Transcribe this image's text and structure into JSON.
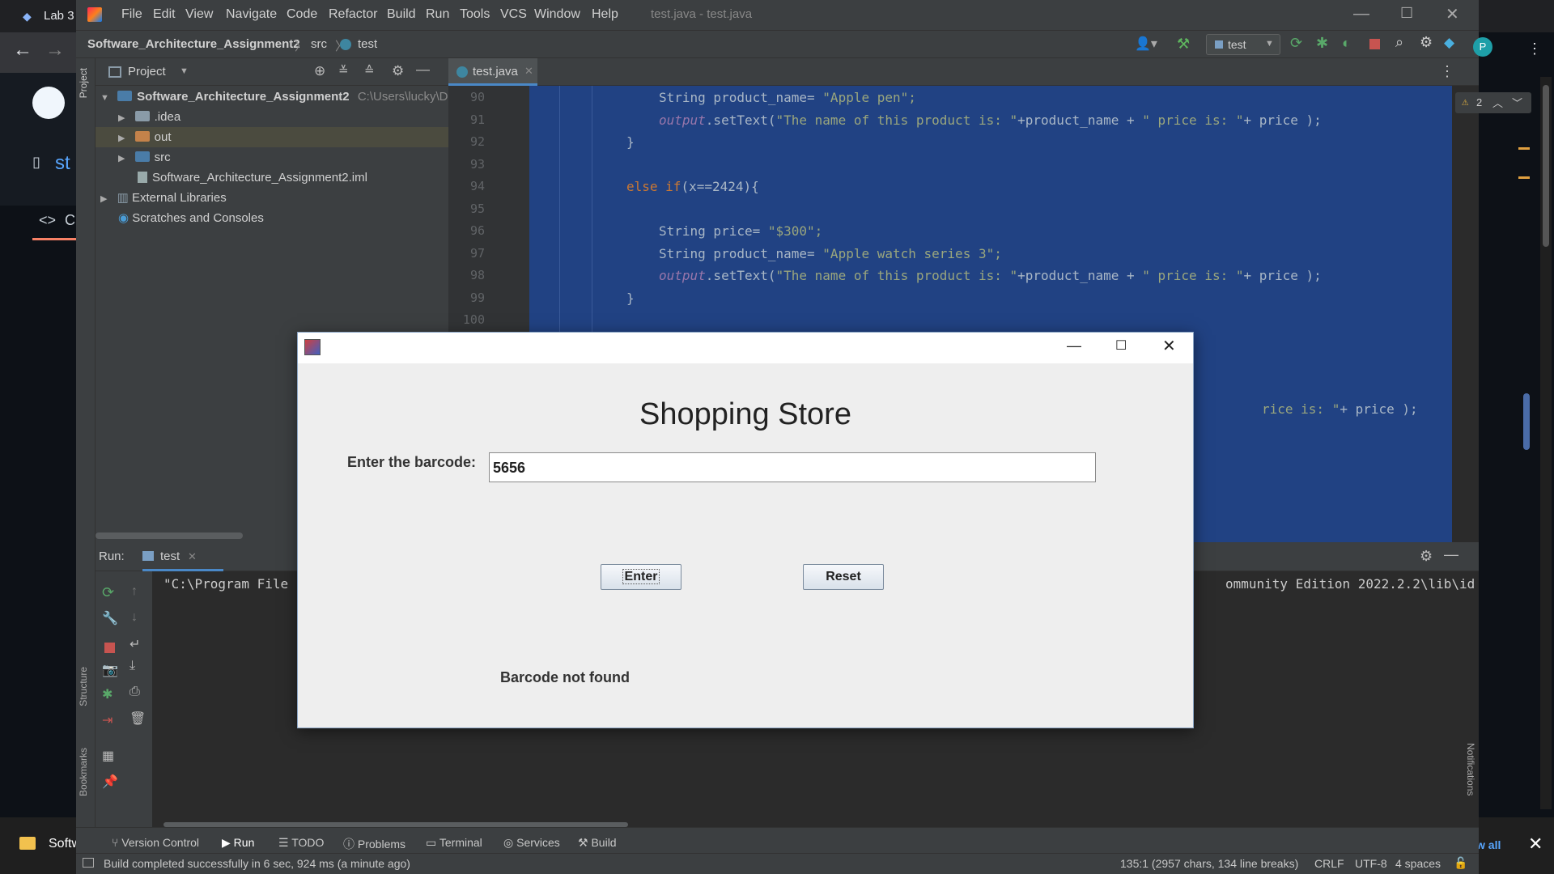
{
  "browser": {
    "tab_title": "Lab 3",
    "repo_label": "st",
    "code_tab": "C",
    "taskbar_app": "Softw",
    "show_all": "w all"
  },
  "ide": {
    "menu": [
      "File",
      "Edit",
      "View",
      "Navigate",
      "Code",
      "Refactor",
      "Build",
      "Run",
      "Tools",
      "VCS",
      "Window",
      "Help"
    ],
    "window_title": "test.java - test.java",
    "breadcrumb": {
      "project": "Software_Architecture_Assignment2",
      "folder": "src",
      "file": "test"
    },
    "run_config": "test",
    "avatar_letter": "P",
    "project_panel": {
      "title": "Project",
      "root": "Software_Architecture_Assignment2",
      "root_path": "C:\\Users\\lucky\\Do",
      "items": [
        ".idea",
        "out",
        "src",
        "Software_Architecture_Assignment2.iml"
      ],
      "external": "External Libraries",
      "scratches": "Scratches and Consoles"
    },
    "editor_tab": "test.java",
    "warning_count": "2",
    "line_numbers": [
      "90",
      "91",
      "92",
      "93",
      "94",
      "95",
      "96",
      "97",
      "98",
      "99",
      "100"
    ],
    "code": {
      "l90_kw": "String product_name= ",
      "l90_str": "\"Apple pen\";",
      "l91_it": "output",
      "l91_a": ".setText(",
      "l91_str1": "\"The name of this product is: \"",
      "l91_b": "+product_name + ",
      "l91_str2": "\" price is: \"",
      "l91_c": "+ price );",
      "l92": "}",
      "l94_kw": "else if",
      "l94_a": "(x==2424){",
      "l96_kw": "String price= ",
      "l96_str": "\"$300\";",
      "l97_kw": "String product_name= ",
      "l97_str": "\"Apple watch series 3\";",
      "l98_it": "output",
      "l98_a": ".setText(",
      "l98_str1": "\"The name of this product is: \"",
      "l98_b": "+product_name + ",
      "l98_str2": "\" price is: \"",
      "l98_c": "+ price );",
      "l99": "}",
      "partial_str": "rice is: \"",
      "partial_c": "+ price );"
    },
    "run_panel": {
      "label": "Run:",
      "tab": "test",
      "console_left": "\"C:\\Program File",
      "console_right": "ommunity Edition 2022.2.2\\lib\\id"
    },
    "side_labels": {
      "project": "Project",
      "structure": "Structure",
      "bookmarks": "Bookmarks",
      "notifications": "Notifications"
    },
    "bottom_tabs": [
      "Version Control",
      "Run",
      "TODO",
      "Problems",
      "Terminal",
      "Services",
      "Build"
    ],
    "status": {
      "message": "Build completed successfully in 6 sec, 924 ms (a minute ago)",
      "position": "135:1 (2957 chars, 134 line breaks)",
      "line_sep": "CRLF",
      "encoding": "UTF-8",
      "indent": "4 spaces"
    }
  },
  "dialog": {
    "title": "Shopping Store",
    "barcode_label": "Enter the barcode:",
    "barcode_value": "5656",
    "enter_button": "Enter",
    "reset_button": "Reset",
    "result": "Barcode not found"
  },
  "colors": {
    "selection": "#214283",
    "ide_bg": "#2b2b2b",
    "panel_bg": "#3c3f41",
    "dialog_bg": "#eeeeee"
  }
}
